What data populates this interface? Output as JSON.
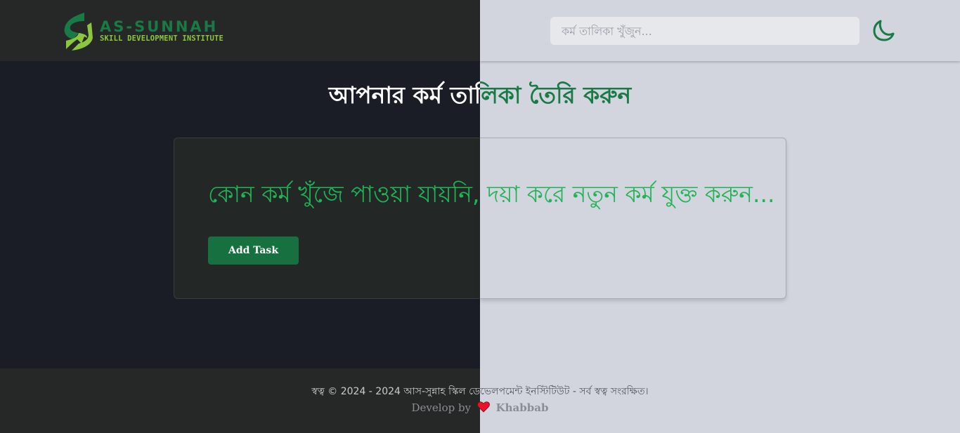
{
  "header": {
    "logo": {
      "title": "AS-SUNNAH",
      "subtitle": "SKILL DEVELOPMENT INSTITUTE"
    },
    "search": {
      "placeholder": "কর্ম তালিকা খুঁজুন..."
    },
    "theme_toggle_icon": "moon-icon"
  },
  "main": {
    "title": "আপনার কর্ম তালিকা তৈরি করুন",
    "empty_message": "কোন কর্ম খুঁজে পাওয়া যায়নি, দয়া করে নতুন কর্ম যুক্ত করুন...",
    "add_button_label": "Add Task"
  },
  "footer": {
    "copyright": "স্বত্ব © 2024 - 2024 আস-সুন্নাহ স্কিল ডেভেলপমেন্ট ইনস্টিটিউট - সর্ব স্বত্ব সংরক্ষিত।",
    "develop_by": "Develop by",
    "developer": "Khabbab",
    "heart_icon": "heart-icon"
  },
  "colors": {
    "brand_green": "#1a7a46",
    "accent_lime": "#8cc63f",
    "message_green": "#1fb455",
    "button_green": "#16703f"
  }
}
